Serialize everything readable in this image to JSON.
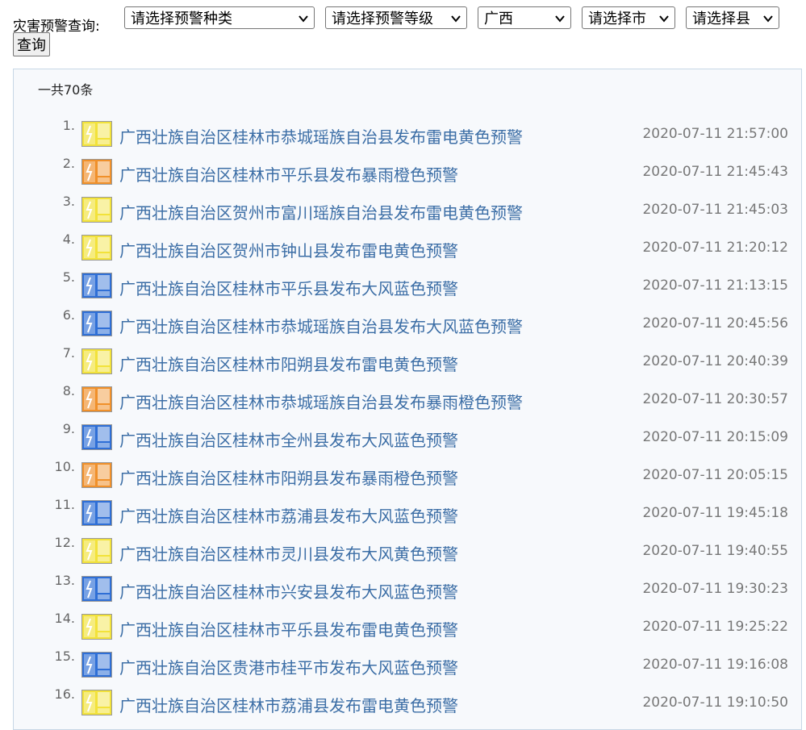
{
  "query": {
    "label": "灾害预警查询:",
    "type_select": "请选择预警种类",
    "level_select": "请选择预警等级",
    "province_select": "广西",
    "city_select": "请选择市",
    "county_select": "请选择县",
    "query_button": "查询"
  },
  "list": {
    "total": "一共70条",
    "items": [
      {
        "num": "1.",
        "title": "广西壮族自治区桂林市恭城瑶族自治县发布雷电黄色预警",
        "time": "2020-07-11 21:57:00",
        "icon": "thunder-yellow-icon",
        "color": "#f2e23a"
      },
      {
        "num": "2.",
        "title": "广西壮族自治区桂林市平乐县发布暴雨橙色预警",
        "time": "2020-07-11 21:45:43",
        "icon": "rainstorm-orange-icon",
        "color": "#f0902a"
      },
      {
        "num": "3.",
        "title": "广西壮族自治区贺州市富川瑶族自治县发布雷电黄色预警",
        "time": "2020-07-11 21:45:03",
        "icon": "thunder-yellow-icon",
        "color": "#f2e23a"
      },
      {
        "num": "4.",
        "title": "广西壮族自治区贺州市钟山县发布雷电黄色预警",
        "time": "2020-07-11 21:20:12",
        "icon": "thunder-yellow-icon",
        "color": "#f2e23a"
      },
      {
        "num": "5.",
        "title": "广西壮族自治区桂林市平乐县发布大风蓝色预警",
        "time": "2020-07-11 21:13:15",
        "icon": "wind-blue-icon",
        "color": "#2f6fd6"
      },
      {
        "num": "6.",
        "title": "广西壮族自治区桂林市恭城瑶族自治县发布大风蓝色预警",
        "time": "2020-07-11 20:45:56",
        "icon": "wind-blue-icon",
        "color": "#2f6fd6"
      },
      {
        "num": "7.",
        "title": "广西壮族自治区桂林市阳朔县发布雷电黄色预警",
        "time": "2020-07-11 20:40:39",
        "icon": "thunder-yellow-icon",
        "color": "#f2e23a"
      },
      {
        "num": "8.",
        "title": "广西壮族自治区桂林市恭城瑶族自治县发布暴雨橙色预警",
        "time": "2020-07-11 20:30:57",
        "icon": "rainstorm-orange-icon",
        "color": "#f0902a"
      },
      {
        "num": "9.",
        "title": "广西壮族自治区桂林市全州县发布大风蓝色预警",
        "time": "2020-07-11 20:15:09",
        "icon": "wind-blue-icon",
        "color": "#2f6fd6"
      },
      {
        "num": "10.",
        "title": "广西壮族自治区桂林市阳朔县发布暴雨橙色预警",
        "time": "2020-07-11 20:05:15",
        "icon": "rainstorm-orange-icon",
        "color": "#f0902a"
      },
      {
        "num": "11.",
        "title": "广西壮族自治区桂林市荔浦县发布大风蓝色预警",
        "time": "2020-07-11 19:45:18",
        "icon": "wind-blue-icon",
        "color": "#2f6fd6"
      },
      {
        "num": "12.",
        "title": "广西壮族自治区桂林市灵川县发布大风黄色预警",
        "time": "2020-07-11 19:40:55",
        "icon": "wind-yellow-icon",
        "color": "#f2e23a"
      },
      {
        "num": "13.",
        "title": "广西壮族自治区桂林市兴安县发布大风蓝色预警",
        "time": "2020-07-11 19:30:23",
        "icon": "wind-blue-icon",
        "color": "#2f6fd6"
      },
      {
        "num": "14.",
        "title": "广西壮族自治区桂林市平乐县发布雷电黄色预警",
        "time": "2020-07-11 19:25:22",
        "icon": "thunder-yellow-icon",
        "color": "#f2e23a"
      },
      {
        "num": "15.",
        "title": "广西壮族自治区贵港市桂平市发布大风蓝色预警",
        "time": "2020-07-11 19:16:08",
        "icon": "wind-blue-icon",
        "color": "#2f6fd6"
      },
      {
        "num": "16.",
        "title": "广西壮族自治区桂林市荔浦县发布雷电黄色预警",
        "time": "2020-07-11 19:10:50",
        "icon": "thunder-yellow-icon",
        "color": "#f2e23a"
      }
    ]
  }
}
